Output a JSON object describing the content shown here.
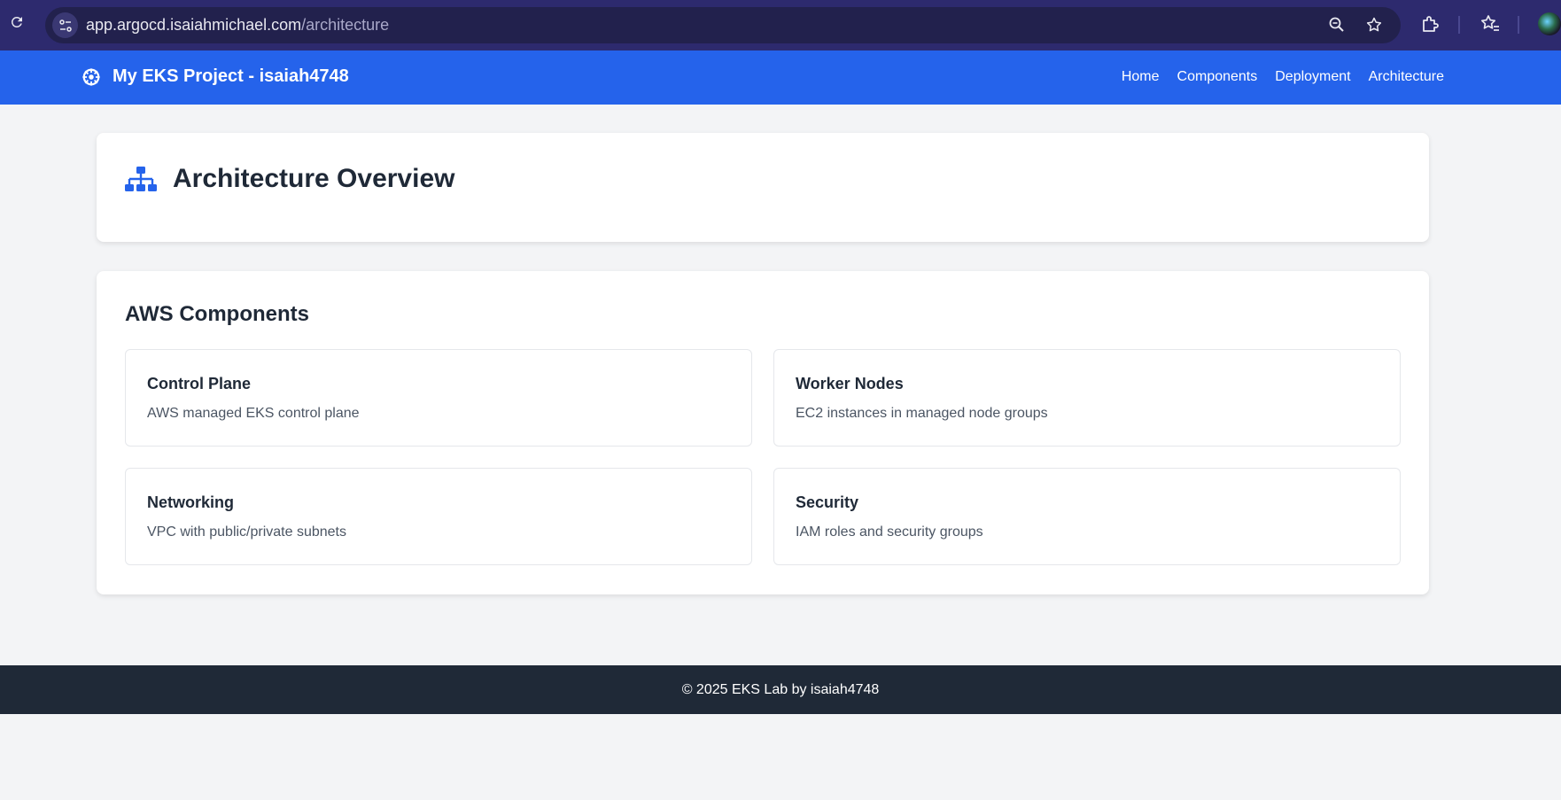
{
  "browser": {
    "url_host": "app.argocd.isaiahmichael.com",
    "url_path": "/architecture"
  },
  "navbar": {
    "brand": "My EKS Project - isaiah4748",
    "links": [
      "Home",
      "Components",
      "Deployment",
      "Architecture"
    ]
  },
  "header": {
    "title": "Architecture Overview",
    "icon": "sitemap-icon"
  },
  "components": {
    "heading": "AWS Components",
    "items": [
      {
        "title": "Control Plane",
        "description": "AWS managed EKS control plane"
      },
      {
        "title": "Worker Nodes",
        "description": "EC2 instances in managed node groups"
      },
      {
        "title": "Networking",
        "description": "VPC with public/private subnets"
      },
      {
        "title": "Security",
        "description": "IAM roles and security groups"
      }
    ]
  },
  "footer": {
    "text": "© 2025 EKS Lab by isaiah4748"
  },
  "colors": {
    "nav": "#2563eb",
    "footer": "#1f2937",
    "background": "#f3f4f6",
    "chrome": "#2d2a6e"
  }
}
